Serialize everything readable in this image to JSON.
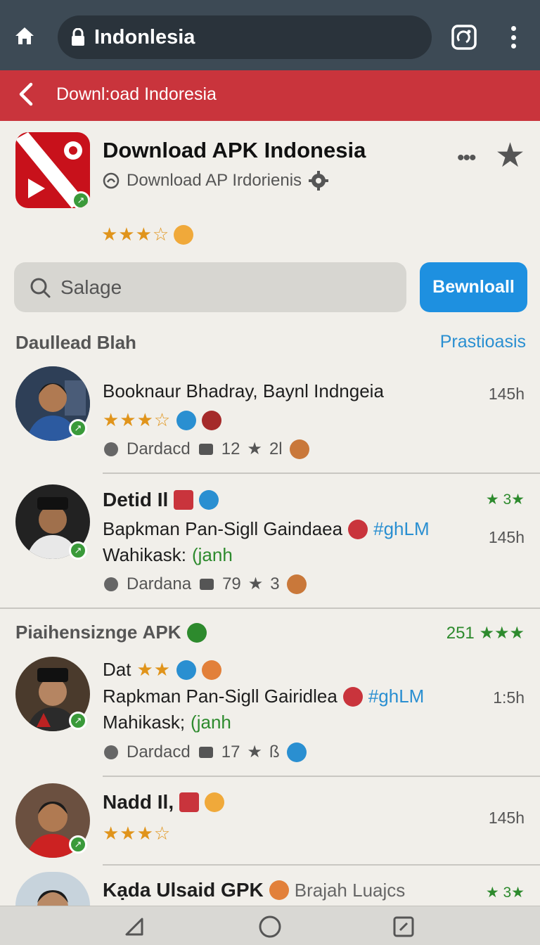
{
  "browser": {
    "url_text": "Indonlesia"
  },
  "header": {
    "title": "Downl:oad Indoresia"
  },
  "app": {
    "title": "Download APK Indonesia",
    "subtitle": "Download AP Irdorienis",
    "rating_stars": "★★★☆",
    "menu_dots": "•••",
    "favorite_star": "★"
  },
  "search": {
    "placeholder": "Salage",
    "button_label": "Bewnloall"
  },
  "section1": {
    "title": "Daullead Blah",
    "link": "Prastioasis"
  },
  "items": [
    {
      "line1": "Booknaur Bhadray, Baynl Indngeia",
      "stars": "★★★☆",
      "time": "145h",
      "meta_label": "Dardacd",
      "meta_count": "12",
      "meta_stars": "2l"
    },
    {
      "name": "Detid Il",
      "line2": "Bapkman Pan-Sigll Gaindaea",
      "hashtag": "#ghLM",
      "line3_label": "Wahikask:",
      "line3_value": "(janh",
      "tag": "★ 3★",
      "time": "145h",
      "meta_label": "Dardana",
      "meta_count": "79",
      "meta_stars": "3"
    }
  ],
  "section2": {
    "title": "Piaihensizngе APK",
    "count": "251",
    "count_stars": "★★★"
  },
  "items2": [
    {
      "name": "Dat",
      "stars": "★★",
      "line2": "Rapkman Pan-Sigll Gairidlea",
      "hashtag": "#ghLM",
      "line3_label": "Mahikask;",
      "line3_value": "(janh",
      "time": "1:5h",
      "meta_label": "Dardacd",
      "meta_count": "17",
      "meta_stars": "ß"
    },
    {
      "name": "Nadd Il,",
      "stars": "★★★☆",
      "time": "145h"
    },
    {
      "name": "Kạda Ulsaid GPK",
      "sub": "Brajah Luajcs",
      "tag": "★ 3★"
    }
  ],
  "colors": {
    "topbar": "#3d4a55",
    "redbar": "#c9343c",
    "accent_blue": "#1e90e0",
    "link_blue": "#2a8fd1",
    "green": "#2d8a2d",
    "star_orange": "#e0941b"
  }
}
